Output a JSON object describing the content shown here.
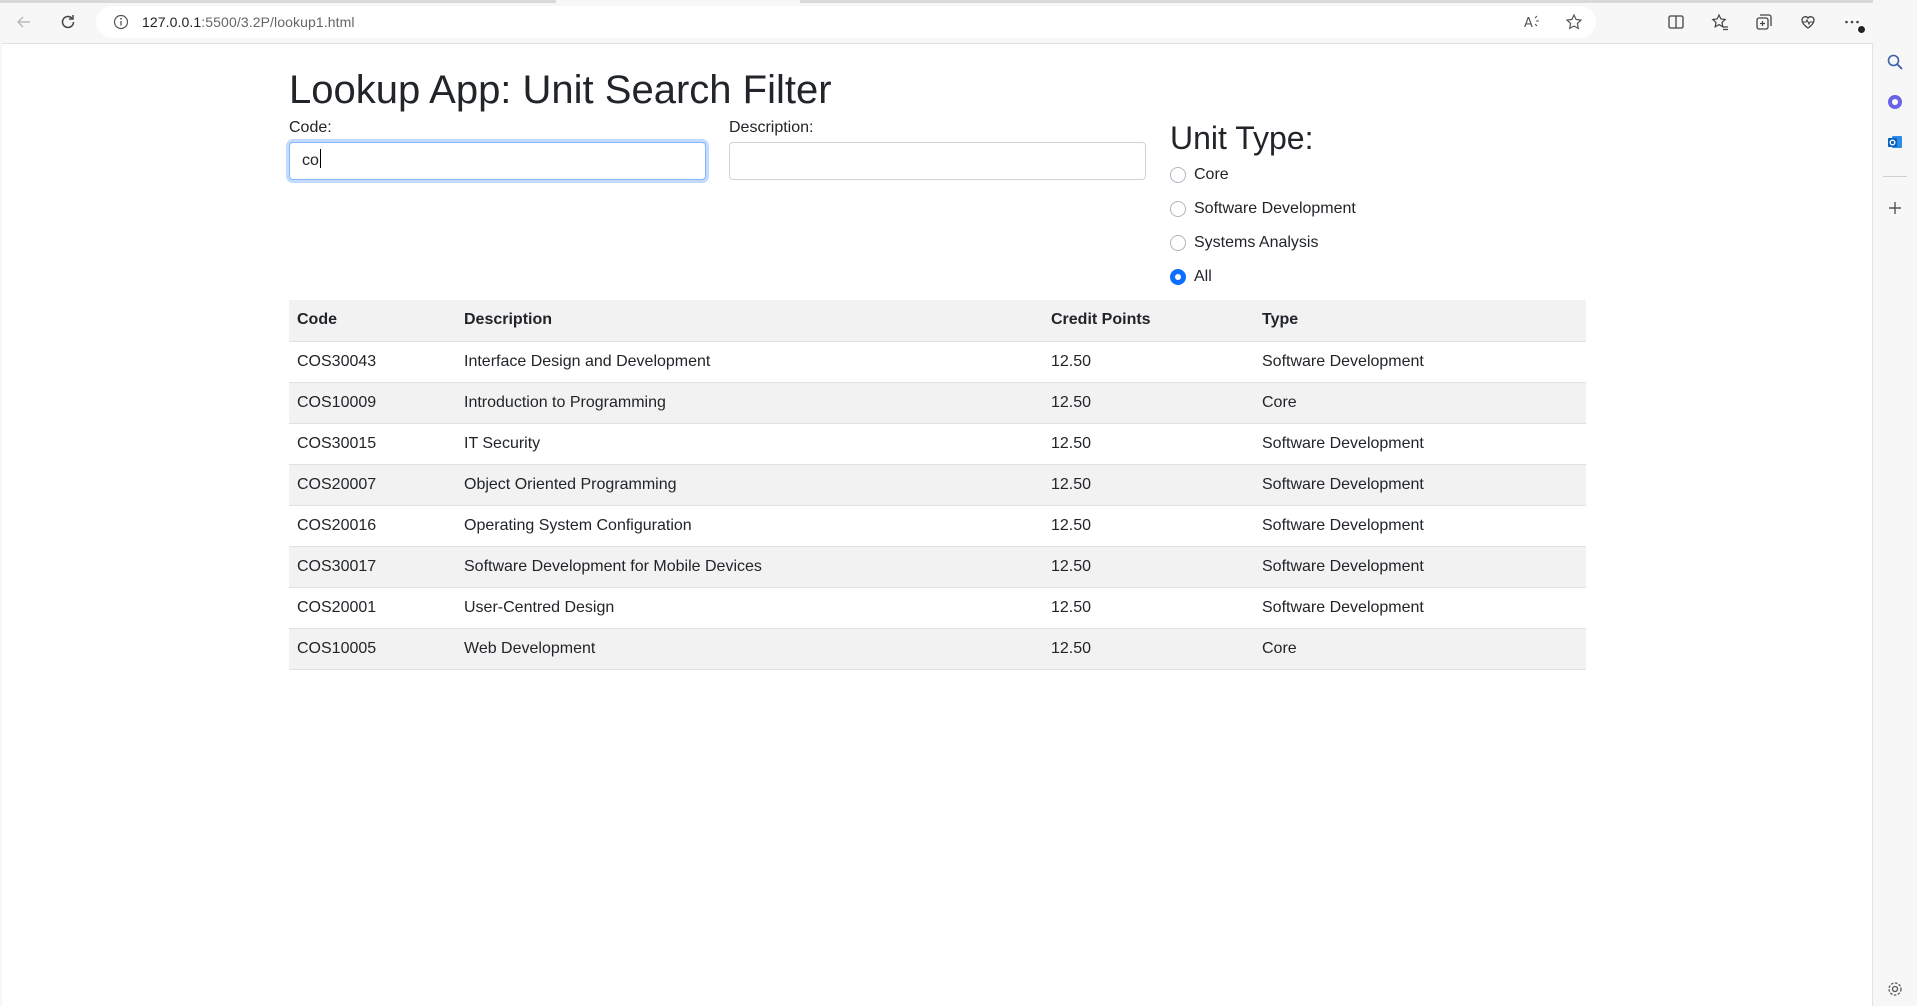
{
  "browser": {
    "url_host": "127.0.0.1",
    "url_path": ":5500/3.2P/lookup1.html"
  },
  "page": {
    "title": "Lookup App: Unit Search Filter",
    "code_label": "Code:",
    "code_value": "co",
    "description_label": "Description:",
    "description_value": "",
    "unit_type_heading": "Unit Type:",
    "unit_types": [
      {
        "label": "Core",
        "checked": false
      },
      {
        "label": "Software Development",
        "checked": false
      },
      {
        "label": "Systems Analysis",
        "checked": false
      },
      {
        "label": "All",
        "checked": true
      }
    ]
  },
  "table": {
    "headers": [
      "Code",
      "Description",
      "Credit Points",
      "Type"
    ],
    "rows": [
      [
        "COS30043",
        "Interface Design and Development",
        "12.50",
        "Software Development"
      ],
      [
        "COS10009",
        "Introduction to Programming",
        "12.50",
        "Core"
      ],
      [
        "COS30015",
        "IT Security",
        "12.50",
        "Software Development"
      ],
      [
        "COS20007",
        "Object Oriented Programming",
        "12.50",
        "Software Development"
      ],
      [
        "COS20016",
        "Operating System Configuration",
        "12.50",
        "Software Development"
      ],
      [
        "COS30017",
        "Software Development for Mobile Devices",
        "12.50",
        "Software Development"
      ],
      [
        "COS20001",
        "User-Centred Design",
        "12.50",
        "Software Development"
      ],
      [
        "COS10005",
        "Web Development",
        "12.50",
        "Core"
      ]
    ]
  },
  "colors": {
    "accent": "#0d6efd",
    "row_stripe": "#f2f2f2"
  }
}
